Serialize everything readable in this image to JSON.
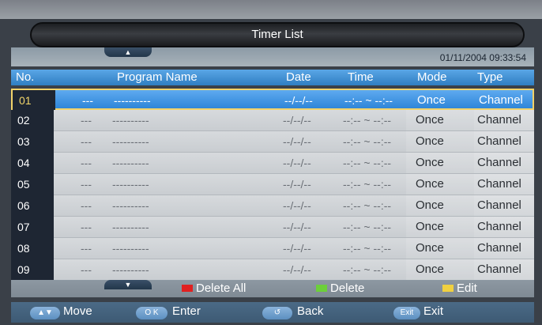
{
  "title": "Timer List",
  "datetime": "01/11/2004 09:33:54",
  "columns": {
    "no": "No.",
    "program": "Program Name",
    "date": "Date",
    "time": "Time",
    "mode": "Mode",
    "type": "Type"
  },
  "scroll_icons": {
    "up": "▲",
    "down": "▼"
  },
  "rows": [
    {
      "no": "01",
      "channel": "---",
      "program": "----------",
      "date": "--/--/--",
      "time": "--:-- ~ --:--",
      "mode": "Once",
      "type": "Channel"
    },
    {
      "no": "02",
      "channel": "---",
      "program": "----------",
      "date": "--/--/--",
      "time": "--:-- ~ --:--",
      "mode": "Once",
      "type": "Channel"
    },
    {
      "no": "03",
      "channel": "---",
      "program": "----------",
      "date": "--/--/--",
      "time": "--:-- ~ --:--",
      "mode": "Once",
      "type": "Channel"
    },
    {
      "no": "04",
      "channel": "---",
      "program": "----------",
      "date": "--/--/--",
      "time": "--:-- ~ --:--",
      "mode": "Once",
      "type": "Channel"
    },
    {
      "no": "05",
      "channel": "---",
      "program": "----------",
      "date": "--/--/--",
      "time": "--:-- ~ --:--",
      "mode": "Once",
      "type": "Channel"
    },
    {
      "no": "06",
      "channel": "---",
      "program": "----------",
      "date": "--/--/--",
      "time": "--:-- ~ --:--",
      "mode": "Once",
      "type": "Channel"
    },
    {
      "no": "07",
      "channel": "---",
      "program": "----------",
      "date": "--/--/--",
      "time": "--:-- ~ --:--",
      "mode": "Once",
      "type": "Channel"
    },
    {
      "no": "08",
      "channel": "---",
      "program": "----------",
      "date": "--/--/--",
      "time": "--:-- ~ --:--",
      "mode": "Once",
      "type": "Channel"
    },
    {
      "no": "09",
      "channel": "---",
      "program": "----------",
      "date": "--/--/--",
      "time": "--:-- ~ --:--",
      "mode": "Once",
      "type": "Channel"
    }
  ],
  "color_legend": {
    "delete_all": {
      "label": "Delete All",
      "color": "#e02020"
    },
    "delete": {
      "label": "Delete",
      "color": "#6ccf3a"
    },
    "edit": {
      "label": "Edit",
      "color": "#f0d040"
    }
  },
  "nav_keys": {
    "move": {
      "key": "▲▼",
      "label": "Move"
    },
    "enter": {
      "key": "O K",
      "label": "Enter"
    },
    "back": {
      "key": "↺",
      "label": "Back"
    },
    "exit": {
      "key": "Exit",
      "label": "Exit"
    }
  }
}
